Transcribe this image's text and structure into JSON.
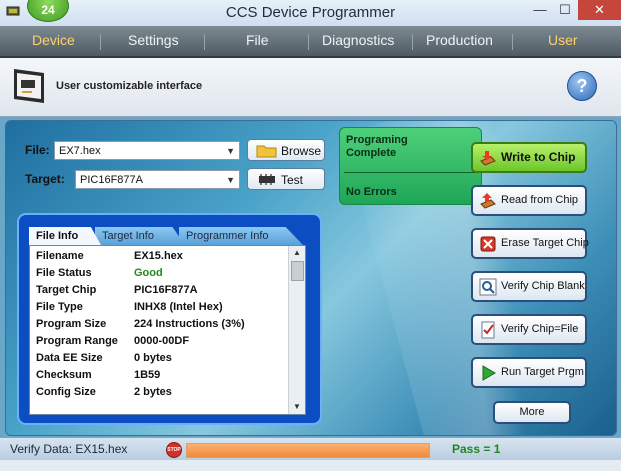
{
  "window": {
    "title": "CCS Device Programmer",
    "badge": "24",
    "min_glyph": "—",
    "max_glyph": "☐",
    "close_glyph": "✕",
    "icon": "programmer-app-icon"
  },
  "menu": {
    "items": [
      {
        "label": "Device",
        "active": true
      },
      {
        "label": "Settings",
        "active": false
      },
      {
        "label": "File",
        "active": false
      },
      {
        "label": "Diagnostics",
        "active": false
      },
      {
        "label": "Production",
        "active": false
      },
      {
        "label": "User",
        "active": true
      }
    ]
  },
  "header": {
    "text": "User customizable interface",
    "help_glyph": "?"
  },
  "file": {
    "label": "File:",
    "value": "EX7.hex",
    "browse_label": "Browse"
  },
  "target": {
    "label": "Target:",
    "value": "PIC16F877A",
    "test_label": "Test"
  },
  "status": {
    "line1": "Programing",
    "line2": "Complete",
    "result": "No Errors",
    "color": "#2bbd63"
  },
  "actions": [
    {
      "label": "Write to Chip",
      "icon": "write-chip-icon",
      "primary": true
    },
    {
      "label": "Read from Chip",
      "icon": "read-chip-icon",
      "primary": false
    },
    {
      "label": "Erase Target Chip",
      "icon": "erase-icon",
      "primary": false
    },
    {
      "label": "Verify Chip Blank",
      "icon": "verify-blank-icon",
      "primary": false
    },
    {
      "label": "Verify Chip=File",
      "icon": "verify-file-icon",
      "primary": false
    },
    {
      "label": "Run Target Prgm",
      "icon": "run-icon",
      "primary": false
    }
  ],
  "more_label": "More",
  "info": {
    "tabs": [
      "File Info",
      "Target Info",
      "Programmer Info"
    ],
    "active_tab": "File Info",
    "rows": [
      {
        "key": "Filename",
        "value": "EX15.hex"
      },
      {
        "key": "File Status",
        "value": "Good"
      },
      {
        "key": "Target Chip",
        "value": "PIC16F877A"
      },
      {
        "key": "File Type",
        "value": "INHX8 (Intel Hex)"
      },
      {
        "key": "Program Size",
        "value": "224 Instructions (3%)"
      },
      {
        "key": "Program Range",
        "value": "0000-00DF"
      },
      {
        "key": "Data EE Size",
        "value": "0 bytes"
      },
      {
        "key": "Checksum",
        "value": "1B59"
      },
      {
        "key": "Config Size",
        "value": "2 bytes"
      }
    ]
  },
  "statusbar": {
    "text": "Verify Data: EX15.hex",
    "stop_label": "STOP",
    "progress": 1.0,
    "progress_color": "#f59a50",
    "pass_text": "Pass = 1"
  },
  "colors": {
    "accent_menu": "#ffd26a",
    "good": "#208a20",
    "panel_blue": "#0c4ec2"
  }
}
